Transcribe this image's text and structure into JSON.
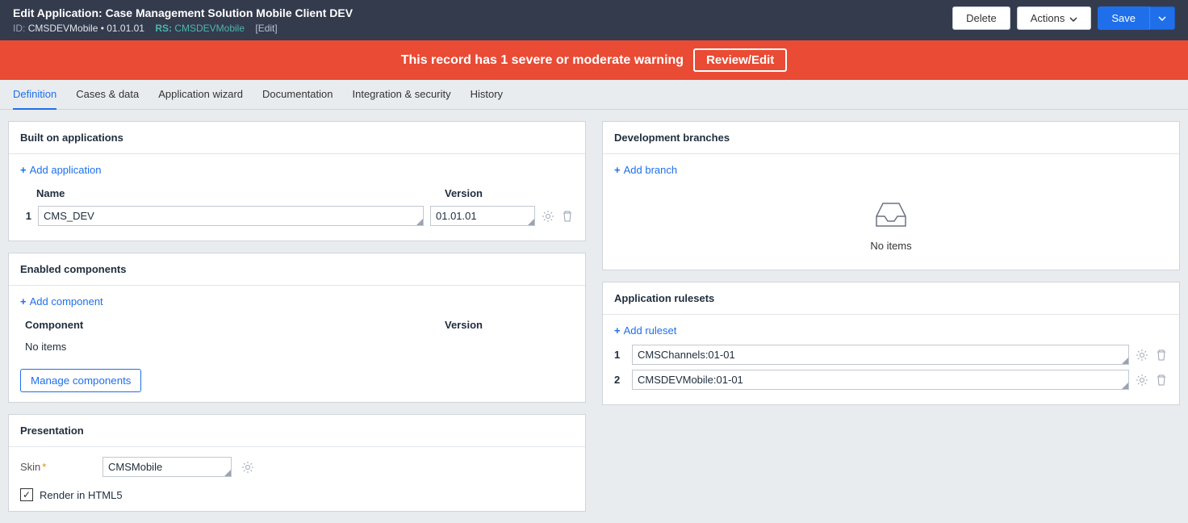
{
  "header": {
    "title": "Edit  Application: Case Management Solution Mobile Client DEV",
    "id_label": "ID:",
    "id_value": "CMSDEVMobile • 01.01.01",
    "rs_label": "RS:",
    "rs_value": "CMSDEVMobile",
    "edit_link": "[Edit]",
    "delete": "Delete",
    "actions": "Actions",
    "save": "Save"
  },
  "alert": {
    "text": "This record has 1 severe or moderate warning",
    "button": "Review/Edit"
  },
  "tabs": {
    "definition": "Definition",
    "cases": "Cases & data",
    "wizard": "Application wizard",
    "docs": "Documentation",
    "security": "Integration & security",
    "history": "History"
  },
  "built": {
    "title": "Built on applications",
    "add": "Add application",
    "name_col": "Name",
    "ver_col": "Version",
    "rows": [
      {
        "idx": "1",
        "name": "CMS_DEV",
        "version": "01.01.01"
      }
    ]
  },
  "components": {
    "title": "Enabled components",
    "add": "Add component",
    "comp_col": "Component",
    "ver_col": "Version",
    "empty": "No items",
    "manage": "Manage components"
  },
  "presentation": {
    "title": "Presentation",
    "skin_label": "Skin",
    "skin_value": "CMSMobile",
    "render": "Render in HTML5"
  },
  "branches": {
    "title": "Development branches",
    "add": "Add branch",
    "empty": "No items"
  },
  "rulesets": {
    "title": "Application rulesets",
    "add": "Add ruleset",
    "rows": [
      {
        "idx": "1",
        "value": "CMSChannels:01-01"
      },
      {
        "idx": "2",
        "value": "CMSDEVMobile:01-01"
      }
    ]
  }
}
